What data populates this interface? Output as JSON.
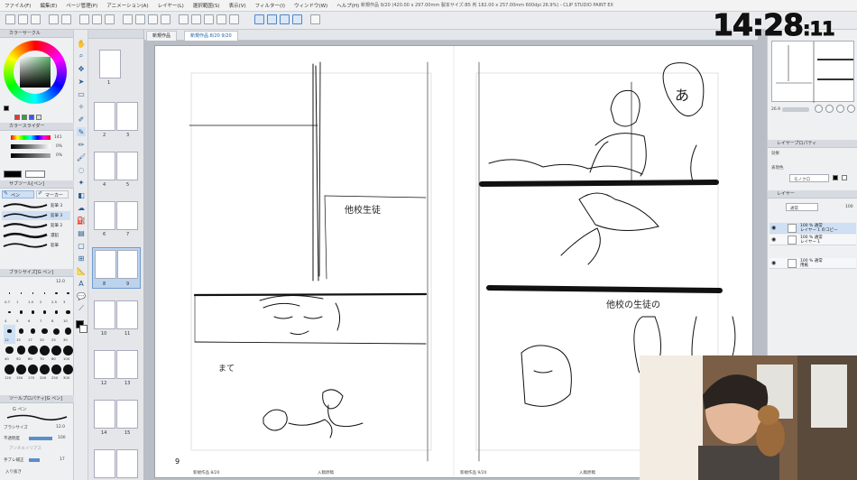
{
  "app": {
    "menus": [
      "ファイル(F)",
      "編集(E)",
      "ページ管理(P)",
      "アニメーション(A)",
      "レイヤー(L)",
      "選択範囲(S)",
      "表示(V)",
      "フィルター(I)",
      "ウィンドウ(W)",
      "ヘルプ(H)"
    ],
    "title": "新規作品 9/20 (420.00 x 297.00mm 製本サイズ:B5 判 182.00 x 257.00mm 600dpi 26.9%) - CLIP STUDIO PAINT EX"
  },
  "overlay": {
    "clock_hm": "14:28",
    "clock_sec": ":11"
  },
  "left_panel": {
    "color_wheel_header": "カラーサークル",
    "color_slider_header": "カラースライダー",
    "slider_values": [
      "141",
      "0%",
      "0%"
    ],
    "subtool_header": "サブツール[ペン]",
    "subtool_tabs": [
      "ペン",
      "マーカー"
    ],
    "brushes": [
      "鉛筆 3",
      "鉛筆 3",
      "鉛筆 2",
      "濃鉛",
      "鉛筆"
    ],
    "brushsize_header": "ブラシサイズ[G ペン]",
    "brush_size_value": "12.0",
    "brush_sizes": [
      "0.7",
      "1",
      "1.5",
      "2",
      "2.5",
      "3",
      "4",
      "5",
      "6",
      "7",
      "8",
      "10",
      "12",
      "15",
      "17",
      "20",
      "25",
      "30",
      "40",
      "50",
      "60",
      "70",
      "80",
      "100",
      "120",
      "150",
      "170",
      "200",
      "250",
      "300"
    ],
    "tool_prop_header": "ツールプロパティ[G ペン]",
    "tool_prop_subheader": "G ペン",
    "props": [
      {
        "label": "ブラシサイズ",
        "value": "12.0"
      },
      {
        "label": "不透明度",
        "value": "100"
      },
      {
        "label": "手ブレ補正",
        "value": "17"
      }
    ],
    "extra_props": [
      "アンチエイリアス",
      "入り抜き"
    ]
  },
  "pages_panel": {
    "pages": [
      {
        "label": "1"
      },
      {
        "label": "2",
        "label2": "3"
      },
      {
        "label": "4",
        "label2": "5"
      },
      {
        "label": "6",
        "label2": "7"
      },
      {
        "label": "8",
        "label2": "9"
      },
      {
        "label": "10",
        "label2": "11"
      },
      {
        "label": "12",
        "label2": "13"
      },
      {
        "label": "14",
        "label2": "15"
      }
    ]
  },
  "canvas": {
    "tabs": [
      "新規作品",
      "新規作品 8/20 9/20"
    ],
    "page_number_left": "9",
    "footer_left": "新規作品 8/20",
    "footer_mid_left": "入稿原稿",
    "footer_mid_right": "新規作品 9/20",
    "footer_right": "入稿原稿"
  },
  "right_panel": {
    "navigator_zoom": "26.9",
    "layer_prop_header": "レイヤープロパティ",
    "effect_label": "効果",
    "expression_label": "表現色",
    "expression_value": "モノクロ",
    "layer_header": "レイヤー",
    "blend_mode": "通常",
    "opacity": "100",
    "layers": [
      {
        "name": "100 % 通常",
        "sub": "レイヤー 1 のコピー"
      },
      {
        "name": "100 % 通常",
        "sub": "レイヤー 1"
      },
      {
        "name": "100 % 通常",
        "sub": "用紙"
      }
    ]
  },
  "colors": {
    "accent": "#1a5ea8",
    "paper": "#ffffff",
    "ui_bg": "#eef0f2",
    "canvas_bg": "#b9bec6"
  }
}
